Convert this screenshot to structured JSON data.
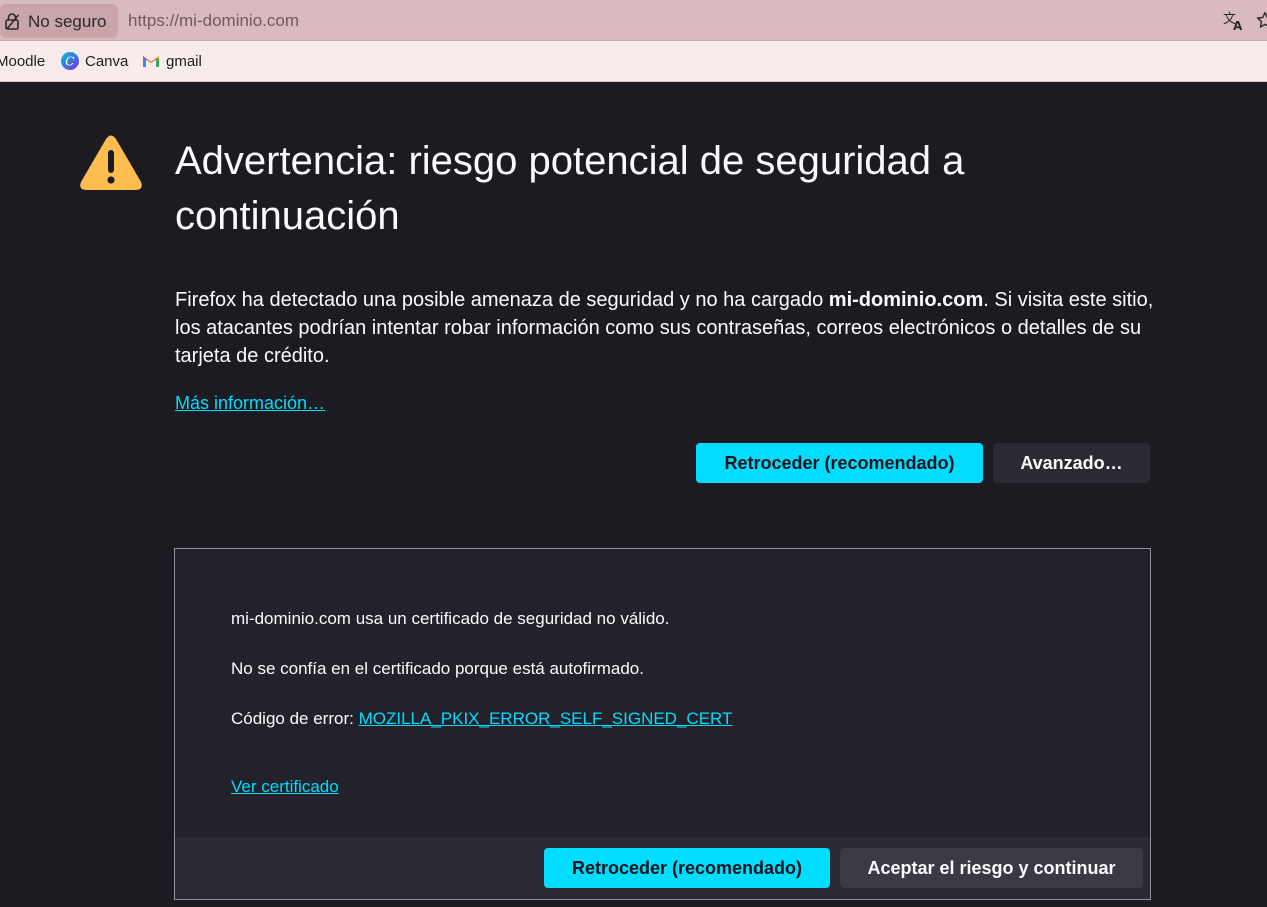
{
  "browser": {
    "security_label": "No seguro",
    "url": "https://mi-dominio.com",
    "icons": {
      "lock": "lock-warning-icon",
      "translate": "translate-icon",
      "bookmark_star": "star-icon"
    }
  },
  "bookmarks": [
    {
      "label": "Moodle",
      "icon": "none"
    },
    {
      "label": "Canva",
      "icon": "canva-icon"
    },
    {
      "label": "gmail",
      "icon": "gmail-icon"
    }
  ],
  "page": {
    "title": "Advertencia: riesgo potencial de seguridad a continuación",
    "intro_before": "Firefox ha detectado una posible amenaza de seguridad y no ha cargado ",
    "intro_domain": "mi-dominio.com",
    "intro_after": ". Si visita este sitio, los atacantes podrían intentar robar información como sus contraseñas, correos electrónicos o detalles de su tarjeta de crédito.",
    "learn_more": "Más información…",
    "go_back_button": "Retroceder (recomendado)",
    "advanced_button": "Avanzado…"
  },
  "advanced": {
    "line1": "mi-dominio.com usa un certificado de seguridad no válido.",
    "line2": "No se confía en el certificado porque está autofirmado.",
    "error_prefix": "Código de error: ",
    "error_code": "MOZILLA_PKIX_ERROR_SELF_SIGNED_CERT",
    "view_certificate": "Ver certificado",
    "go_back_button": "Retroceder (recomendado)",
    "accept_button": "Aceptar el riesgo y continuar"
  },
  "colors": {
    "page_background": "#1c1b22",
    "accent": "#00ddff",
    "warning": "#ffbd4f",
    "urlbar_background": "#d9bbbf",
    "bookmarks_background": "#f7ebeb"
  }
}
